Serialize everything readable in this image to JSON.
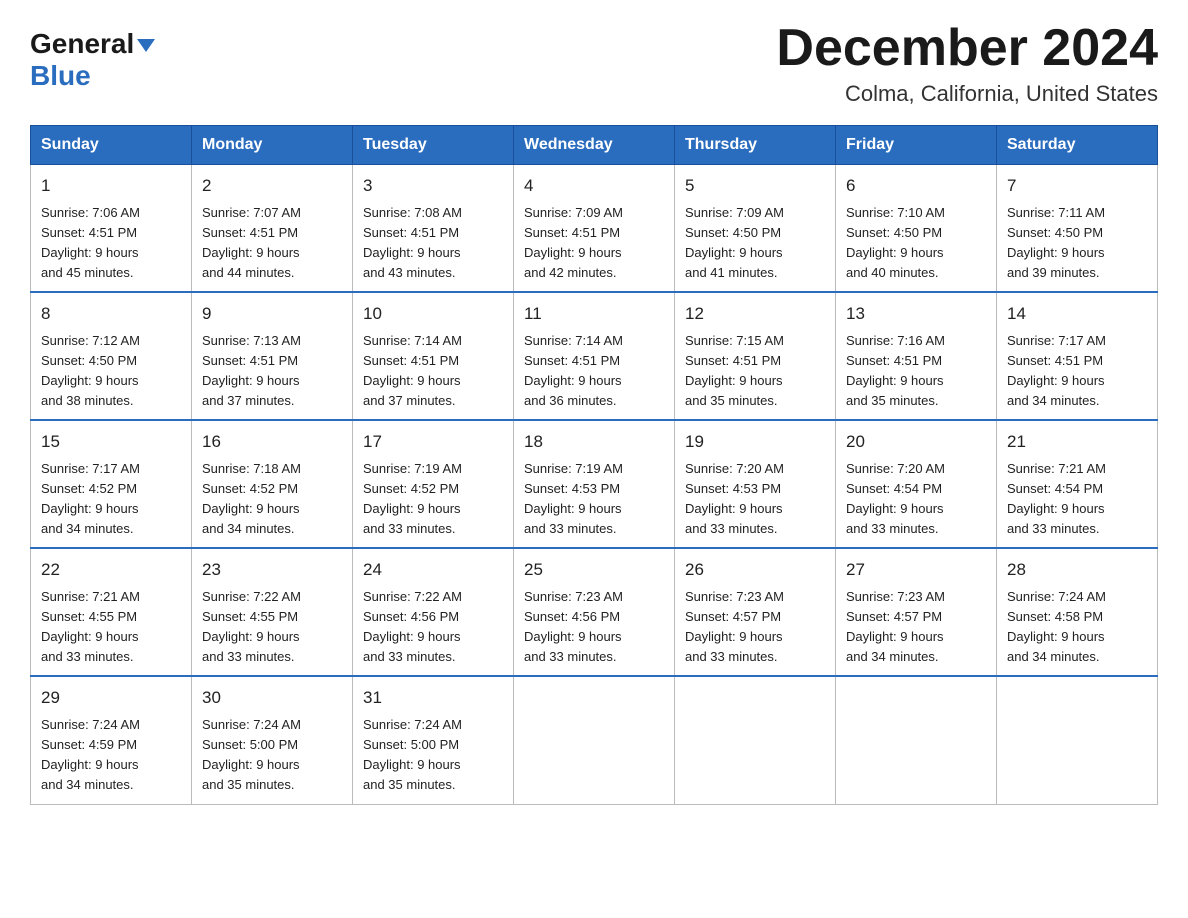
{
  "header": {
    "logo_general": "General",
    "logo_blue": "Blue",
    "title": "December 2024",
    "location": "Colma, California, United States"
  },
  "days_of_week": [
    "Sunday",
    "Monday",
    "Tuesday",
    "Wednesday",
    "Thursday",
    "Friday",
    "Saturday"
  ],
  "weeks": [
    [
      {
        "day": "1",
        "sunrise": "7:06 AM",
        "sunset": "4:51 PM",
        "daylight": "9 hours and 45 minutes."
      },
      {
        "day": "2",
        "sunrise": "7:07 AM",
        "sunset": "4:51 PM",
        "daylight": "9 hours and 44 minutes."
      },
      {
        "day": "3",
        "sunrise": "7:08 AM",
        "sunset": "4:51 PM",
        "daylight": "9 hours and 43 minutes."
      },
      {
        "day": "4",
        "sunrise": "7:09 AM",
        "sunset": "4:51 PM",
        "daylight": "9 hours and 42 minutes."
      },
      {
        "day": "5",
        "sunrise": "7:09 AM",
        "sunset": "4:50 PM",
        "daylight": "9 hours and 41 minutes."
      },
      {
        "day": "6",
        "sunrise": "7:10 AM",
        "sunset": "4:50 PM",
        "daylight": "9 hours and 40 minutes."
      },
      {
        "day": "7",
        "sunrise": "7:11 AM",
        "sunset": "4:50 PM",
        "daylight": "9 hours and 39 minutes."
      }
    ],
    [
      {
        "day": "8",
        "sunrise": "7:12 AM",
        "sunset": "4:50 PM",
        "daylight": "9 hours and 38 minutes."
      },
      {
        "day": "9",
        "sunrise": "7:13 AM",
        "sunset": "4:51 PM",
        "daylight": "9 hours and 37 minutes."
      },
      {
        "day": "10",
        "sunrise": "7:14 AM",
        "sunset": "4:51 PM",
        "daylight": "9 hours and 37 minutes."
      },
      {
        "day": "11",
        "sunrise": "7:14 AM",
        "sunset": "4:51 PM",
        "daylight": "9 hours and 36 minutes."
      },
      {
        "day": "12",
        "sunrise": "7:15 AM",
        "sunset": "4:51 PM",
        "daylight": "9 hours and 35 minutes."
      },
      {
        "day": "13",
        "sunrise": "7:16 AM",
        "sunset": "4:51 PM",
        "daylight": "9 hours and 35 minutes."
      },
      {
        "day": "14",
        "sunrise": "7:17 AM",
        "sunset": "4:51 PM",
        "daylight": "9 hours and 34 minutes."
      }
    ],
    [
      {
        "day": "15",
        "sunrise": "7:17 AM",
        "sunset": "4:52 PM",
        "daylight": "9 hours and 34 minutes."
      },
      {
        "day": "16",
        "sunrise": "7:18 AM",
        "sunset": "4:52 PM",
        "daylight": "9 hours and 34 minutes."
      },
      {
        "day": "17",
        "sunrise": "7:19 AM",
        "sunset": "4:52 PM",
        "daylight": "9 hours and 33 minutes."
      },
      {
        "day": "18",
        "sunrise": "7:19 AM",
        "sunset": "4:53 PM",
        "daylight": "9 hours and 33 minutes."
      },
      {
        "day": "19",
        "sunrise": "7:20 AM",
        "sunset": "4:53 PM",
        "daylight": "9 hours and 33 minutes."
      },
      {
        "day": "20",
        "sunrise": "7:20 AM",
        "sunset": "4:54 PM",
        "daylight": "9 hours and 33 minutes."
      },
      {
        "day": "21",
        "sunrise": "7:21 AM",
        "sunset": "4:54 PM",
        "daylight": "9 hours and 33 minutes."
      }
    ],
    [
      {
        "day": "22",
        "sunrise": "7:21 AM",
        "sunset": "4:55 PM",
        "daylight": "9 hours and 33 minutes."
      },
      {
        "day": "23",
        "sunrise": "7:22 AM",
        "sunset": "4:55 PM",
        "daylight": "9 hours and 33 minutes."
      },
      {
        "day": "24",
        "sunrise": "7:22 AM",
        "sunset": "4:56 PM",
        "daylight": "9 hours and 33 minutes."
      },
      {
        "day": "25",
        "sunrise": "7:23 AM",
        "sunset": "4:56 PM",
        "daylight": "9 hours and 33 minutes."
      },
      {
        "day": "26",
        "sunrise": "7:23 AM",
        "sunset": "4:57 PM",
        "daylight": "9 hours and 33 minutes."
      },
      {
        "day": "27",
        "sunrise": "7:23 AM",
        "sunset": "4:57 PM",
        "daylight": "9 hours and 34 minutes."
      },
      {
        "day": "28",
        "sunrise": "7:24 AM",
        "sunset": "4:58 PM",
        "daylight": "9 hours and 34 minutes."
      }
    ],
    [
      {
        "day": "29",
        "sunrise": "7:24 AM",
        "sunset": "4:59 PM",
        "daylight": "9 hours and 34 minutes."
      },
      {
        "day": "30",
        "sunrise": "7:24 AM",
        "sunset": "5:00 PM",
        "daylight": "9 hours and 35 minutes."
      },
      {
        "day": "31",
        "sunrise": "7:24 AM",
        "sunset": "5:00 PM",
        "daylight": "9 hours and 35 minutes."
      },
      null,
      null,
      null,
      null
    ]
  ],
  "labels": {
    "sunrise": "Sunrise:",
    "sunset": "Sunset:",
    "daylight": "Daylight:"
  }
}
